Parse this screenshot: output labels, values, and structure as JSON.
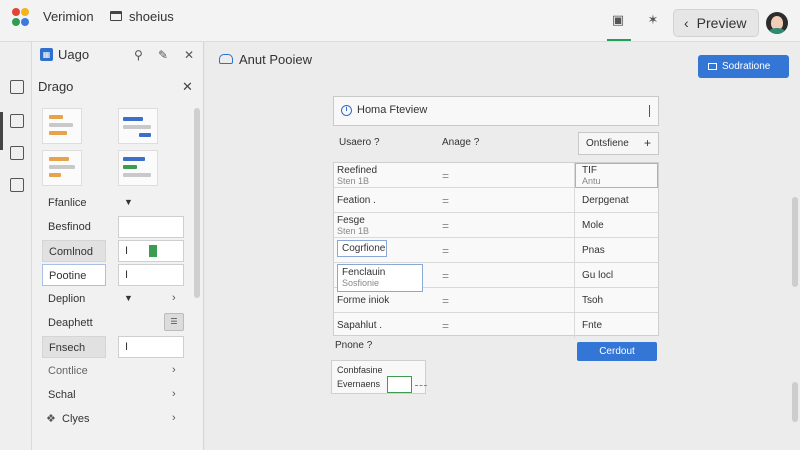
{
  "header": {
    "app_title": "Verimion",
    "project_name": "shoeius",
    "preview_label": "Preview"
  },
  "sidebar": {
    "title": "Uago",
    "section_title": "Drago",
    "properties": [
      {
        "label": "Ffanlice",
        "value": "",
        "control": "caret",
        "style": "plain"
      },
      {
        "label": "Besfinod",
        "value": "",
        "control": "input",
        "style": "plain"
      },
      {
        "label": "Comlnod",
        "value": "I",
        "control": "green",
        "style": "shaded"
      },
      {
        "label": "Pootine",
        "value": "I",
        "control": "input",
        "style": "boxed"
      },
      {
        "label": "Deplion",
        "value": "",
        "control": "caret-chev",
        "style": "plain"
      },
      {
        "label": "Deaphett",
        "value": "",
        "control": "button",
        "style": "plain"
      },
      {
        "label": "Fnsech",
        "value": "I",
        "control": "input",
        "style": "shaded"
      },
      {
        "label": "Contlice",
        "value": "",
        "control": "chev",
        "style": "plain"
      },
      {
        "label": "Schal",
        "value": "",
        "control": "chev",
        "style": "plain"
      },
      {
        "label": "Clyes",
        "value": "",
        "control": "chev",
        "style": "plain"
      }
    ]
  },
  "main": {
    "title": "Anut Pooiew",
    "primary_button": "Sodratione",
    "card_title": "Homa Fteview",
    "col1_label": "Usaero ?",
    "col2_label": "Anage ?",
    "col_select": "Ontsfiene",
    "rows": [
      {
        "name": "Reefined",
        "sub": "Sten 1B",
        "value": "TIF",
        "value_sub": "Antu"
      },
      {
        "name": "Feation .",
        "sub": "",
        "value": "Derpgenat",
        "value_sub": ""
      },
      {
        "name": "Fesge",
        "sub": "Sten 1B",
        "value": "Mole",
        "value_sub": ""
      },
      {
        "name": "Cogrfione",
        "sub": "",
        "value": "Pnas",
        "value_sub": ""
      },
      {
        "name": "Fenclauin",
        "sub": "Sosfionie",
        "value": "Gu  locl",
        "value_sub": ""
      },
      {
        "name": "Forme iniok",
        "sub": "",
        "value": "Tsoh",
        "value_sub": ""
      },
      {
        "name": "Sapahlut .",
        "sub": "",
        "value": "Fnte",
        "value_sub": ""
      }
    ],
    "frame_label": "Pnone ?",
    "frame_row1": "Conbfasine",
    "frame_row2": "Evernaens",
    "secondary_button": "Cerdout"
  }
}
